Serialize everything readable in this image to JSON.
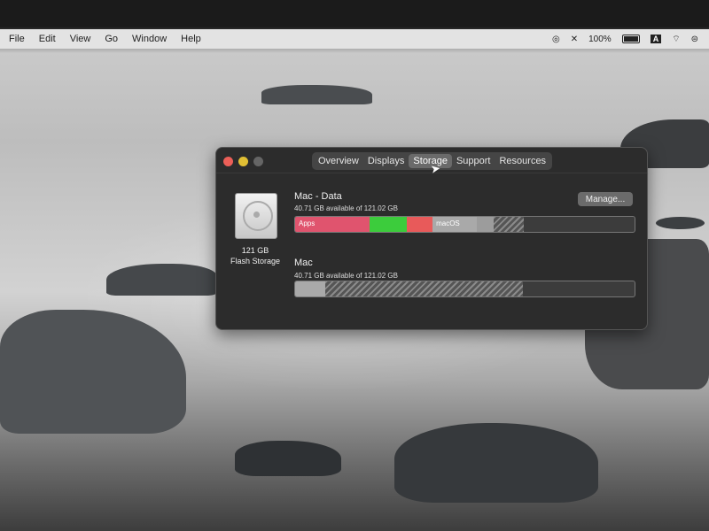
{
  "menubar": {
    "items": [
      "File",
      "Edit",
      "View",
      "Go",
      "Window",
      "Help"
    ],
    "battery": "100%",
    "input_source": "A"
  },
  "window": {
    "tabs": [
      "Overview",
      "Displays",
      "Storage",
      "Support",
      "Resources"
    ],
    "active_tab": "Storage",
    "disk": {
      "capacity": "121 GB",
      "type": "Flash Storage"
    },
    "manage_label": "Manage...",
    "volumes": [
      {
        "name": "Mac - Data",
        "available": "40.71 GB available of 121.02 GB",
        "segments": [
          {
            "label": "Apps",
            "color": "#e0546e",
            "fraction": 0.22
          },
          {
            "label": "",
            "color": "#3ccc3c",
            "fraction": 0.11
          },
          {
            "label": "",
            "color": "#e85a5a",
            "fraction": 0.075
          },
          {
            "label": "macOS",
            "color": "#a9a9a9",
            "fraction": 0.13
          },
          {
            "label": "",
            "color": "#9c9c9c",
            "fraction": 0.05
          },
          {
            "label": "",
            "color": "hatch",
            "fraction": 0.09
          }
        ]
      },
      {
        "name": "Mac",
        "available": "40.71 GB available of 121.02 GB",
        "segments": [
          {
            "label": "",
            "color": "#a9a9a9",
            "fraction": 0.09
          },
          {
            "label": "",
            "color": "hatch",
            "fraction": 0.58
          }
        ]
      }
    ]
  },
  "colors": {
    "window_bg": "#2c2c2c",
    "tab_active": "#6a6a6a",
    "close": "#ec5f58",
    "minimize": "#e1bf34"
  }
}
